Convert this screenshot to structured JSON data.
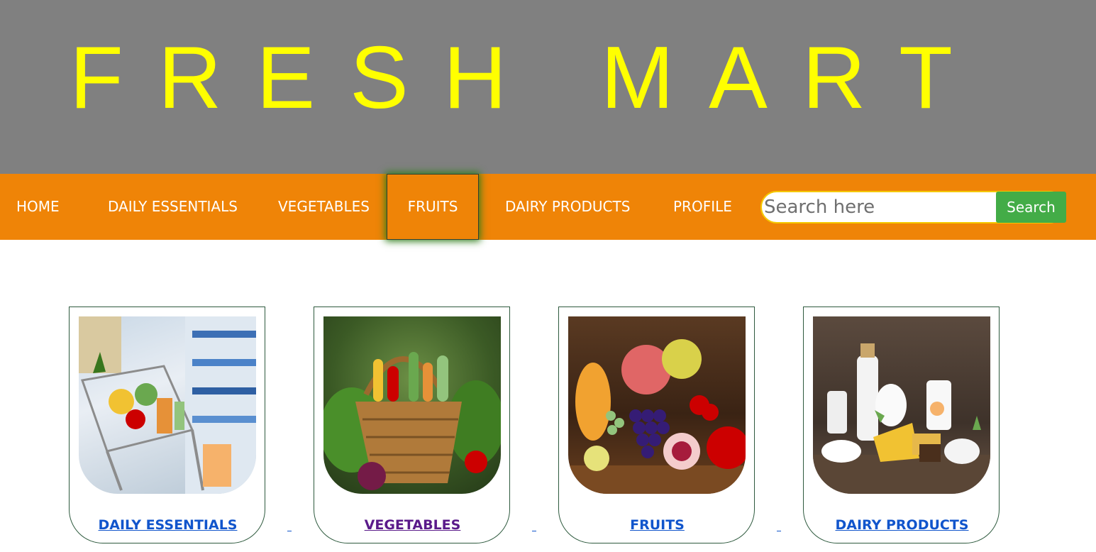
{
  "header": {
    "brand": "FRESH MART"
  },
  "nav": {
    "items": [
      {
        "label": "HOME"
      },
      {
        "label": "DAILY ESSENTIALS"
      },
      {
        "label": "VEGETABLES"
      },
      {
        "label": "FRUITS"
      },
      {
        "label": "DAIRY PRODUCTS"
      },
      {
        "label": "PROFILE"
      }
    ],
    "active": "FRUITS"
  },
  "search": {
    "placeholder": "Search here",
    "value": "",
    "button_label": "Search"
  },
  "categories": [
    {
      "label": "DAILY ESSENTIALS",
      "image": "shopping-cart-aisle-image",
      "visited": false
    },
    {
      "label": "VEGETABLES",
      "image": "vegetable-basket-image",
      "visited": true
    },
    {
      "label": "FRUITS",
      "image": "fruit-assortment-image",
      "visited": false
    },
    {
      "label": "DAIRY PRODUCTS",
      "image": "dairy-products-image",
      "visited": false
    }
  ],
  "colors": {
    "header_bg": "#808080",
    "brand_text": "#ffff00",
    "nav_bg": "#ef8407",
    "search_button": "#43ac47",
    "link": "#1155cc",
    "visited_link": "#5a1a8a"
  }
}
